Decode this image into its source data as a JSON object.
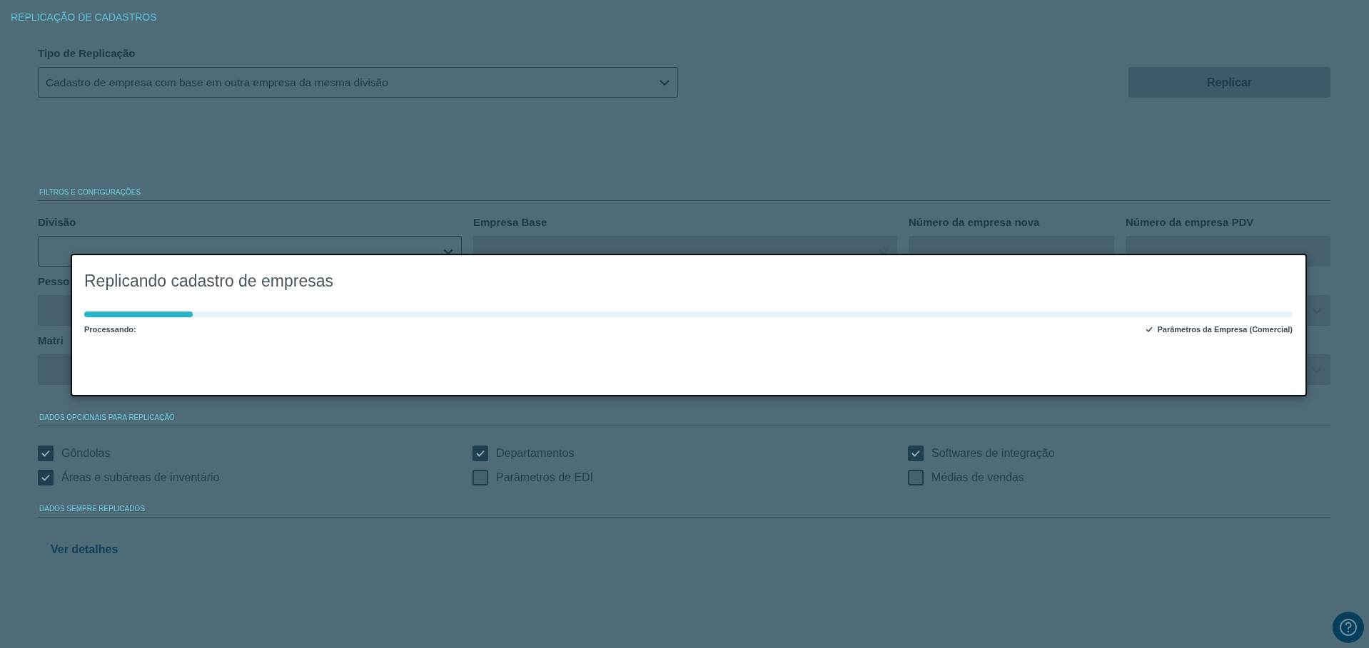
{
  "page_title": "REPLICAÇÃO DE CADASTROS",
  "replication_type": {
    "label": "Tipo de Replicação",
    "value": "Cadastro de empresa com base em outra empresa da mesma divisão"
  },
  "replicate_button": {
    "label": "Replicar",
    "disabled": true
  },
  "filters": {
    "heading": "FILTROS E CONFIGURAÇÕES",
    "rows": [
      {
        "fields": [
          {
            "label": "Divisão",
            "kind": "select",
            "disabled": false
          },
          {
            "label": "Empresa Base",
            "kind": "select",
            "disabled": true
          },
          {
            "label": "Número da empresa nova",
            "kind": "input",
            "disabled": true
          },
          {
            "label": "Número da empresa PDV",
            "kind": "input",
            "disabled": true
          }
        ]
      },
      {
        "fields": [
          {
            "label": "Pesso",
            "kind": "field",
            "disabled": true
          },
          {
            "kind": "select",
            "disabled": true
          }
        ]
      },
      {
        "fields": [
          {
            "label": "Matri",
            "kind": "field",
            "disabled": true
          },
          {
            "kind": "select",
            "disabled": true
          }
        ]
      }
    ]
  },
  "optional_data": {
    "heading": "DADOS OPCIONAIS PARA REPLICAÇÃO",
    "options": [
      {
        "label": "Gôndolas",
        "checked": true
      },
      {
        "label": "Departamentos",
        "checked": true
      },
      {
        "label": "Softwares de integração",
        "checked": true
      },
      {
        "label": "Áreas e subáreas de inventário",
        "checked": true
      },
      {
        "label": "Parâmetros de EDI",
        "checked": false
      },
      {
        "label": "Médias de vendas",
        "checked": false
      }
    ]
  },
  "always_replicated": {
    "heading": "DADOS SEMPRE REPLICADOS",
    "link": "Ver detalhes"
  },
  "dialog": {
    "title": "Replicando cadastro de empresas",
    "progress": {
      "level": 0.09
    },
    "status_label": "Processando:",
    "current_step": "Parâmetros da Empresa (Comercial)"
  }
}
